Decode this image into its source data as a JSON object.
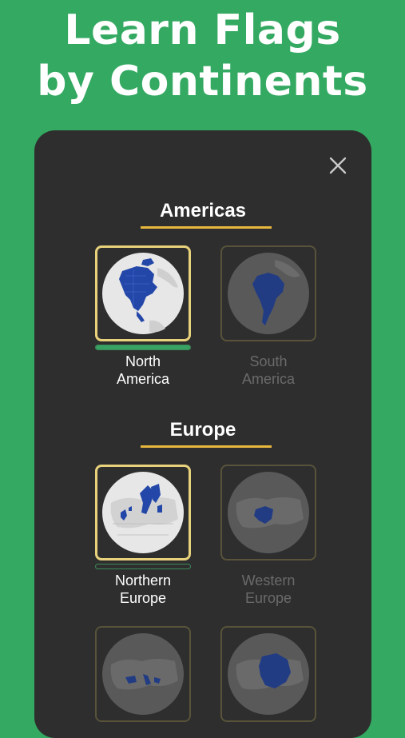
{
  "headline": {
    "line1": "Learn Flags",
    "line2": "by Continents"
  },
  "panel": {
    "close_icon": "close-icon",
    "sections": [
      {
        "title": "Americas",
        "items": [
          {
            "line1": "North",
            "line2": "America",
            "active": true,
            "progress": 1.0
          },
          {
            "line1": "South",
            "line2": "America",
            "active": false
          }
        ]
      },
      {
        "title": "Europe",
        "items": [
          {
            "line1": "Northern",
            "line2": "Europe",
            "active": true,
            "progress": 0.0
          },
          {
            "line1": "Western",
            "line2": "Europe",
            "active": false
          },
          {
            "line1": "",
            "line2": "",
            "active": false
          },
          {
            "line1": "",
            "line2": "",
            "active": false
          }
        ]
      }
    ]
  },
  "colors": {
    "background": "#33a961",
    "panel": "#2e2e2e",
    "accent_underline": "#e8b73d",
    "active_border": "#e8d27c",
    "highlight_region": "#2347a8"
  }
}
